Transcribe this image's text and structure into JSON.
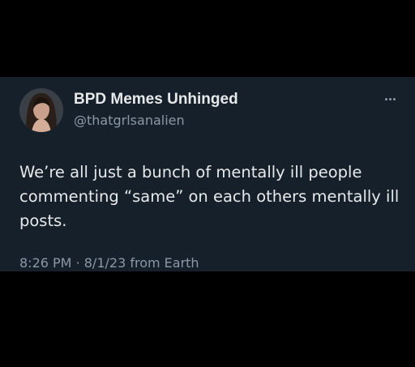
{
  "author": {
    "display_name": "BPD Memes Unhinged",
    "handle": "@thatgrlsanalien"
  },
  "tweet": {
    "text": "We’re all just a bunch of mentally ill people commenting “same” on each others mentally ill posts.",
    "time": "8:26 PM",
    "separator": "·",
    "date": "8/1/23",
    "source": "from Earth"
  },
  "icons": {
    "more": "more-horizontal-icon",
    "avatar": "profile-photo"
  },
  "colors": {
    "background": "#000000",
    "card": "#15202b",
    "primary_text": "#e7e9ea",
    "secondary_text": "#8b98a5"
  }
}
